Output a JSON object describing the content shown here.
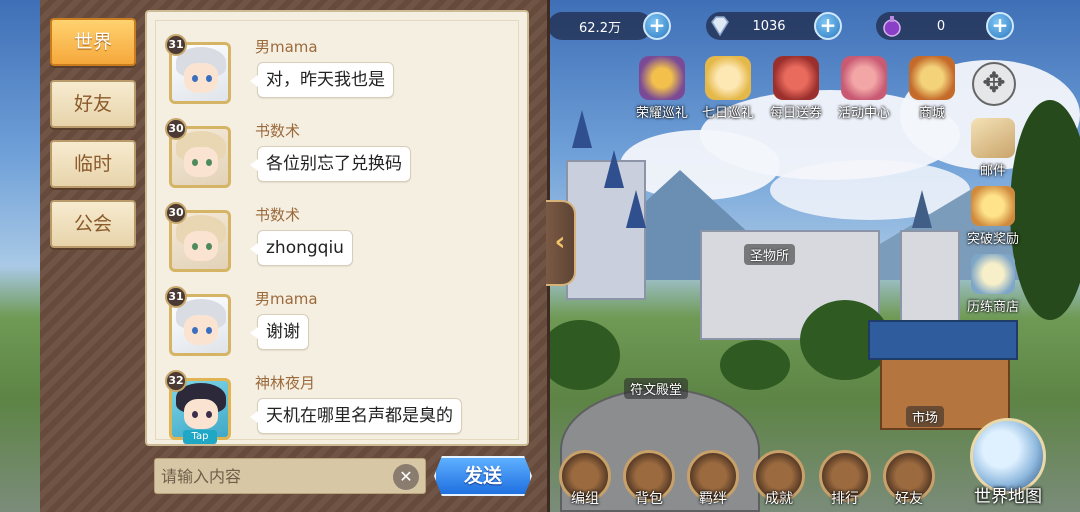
{
  "resources": {
    "gold": "62.2万",
    "diamonds": "1036",
    "potion": "0"
  },
  "features_top": [
    {
      "label": "荣耀巡礼",
      "icon": "honor-tour-icon"
    },
    {
      "label": "七日巡礼",
      "icon": "seven-day-icon"
    },
    {
      "label": "每日送券",
      "icon": "daily-ticket-icon"
    },
    {
      "label": "活动中心",
      "icon": "event-center-icon"
    },
    {
      "label": "商城",
      "icon": "shop-icon",
      "badge": "shop"
    }
  ],
  "features_side": [
    {
      "label": "邮件",
      "icon": "mail-icon"
    },
    {
      "label": "突破奖励",
      "icon": "breakthrough-reward-icon"
    },
    {
      "label": "历练商店",
      "icon": "training-shop-icon"
    }
  ],
  "places": {
    "relic": "圣物所",
    "rune": "符文殿堂",
    "market": "市场"
  },
  "bottom_menu": [
    {
      "label": "编组",
      "icon": "team-icon"
    },
    {
      "label": "背包",
      "icon": "bag-icon"
    },
    {
      "label": "羁绊",
      "icon": "bond-icon"
    },
    {
      "label": "成就",
      "icon": "achievement-icon"
    },
    {
      "label": "排行",
      "icon": "ranking-icon"
    },
    {
      "label": "好友",
      "icon": "friends-icon"
    }
  ],
  "world_map": {
    "label": "世界地图"
  },
  "chat": {
    "tabs": [
      {
        "label": "世界",
        "active": true
      },
      {
        "label": "好友",
        "active": false
      },
      {
        "label": "临时",
        "active": false
      },
      {
        "label": "公会",
        "active": false
      }
    ],
    "messages": [
      {
        "level": "31",
        "name": "男mama",
        "text": "对，昨天我也是",
        "avatar": "white-hair"
      },
      {
        "level": "30",
        "name": "书数术",
        "text": "各位别忘了兑换码",
        "avatar": "blonde-hair"
      },
      {
        "level": "30",
        "name": "书数术",
        "text": "zhongqiu",
        "avatar": "blonde-hair"
      },
      {
        "level": "31",
        "name": "男mama",
        "text": "谢谢",
        "avatar": "white-hair"
      },
      {
        "level": "32",
        "name": "神林夜月",
        "text": "天机在哪里名声都是臭的",
        "avatar": "dark-hair",
        "tag": "Tap"
      }
    ],
    "input_placeholder": "请输入内容",
    "send_label": "发送"
  },
  "colors": {
    "active_tab": "#f5a83b",
    "send_button": "#1f6fe0",
    "panel_bg": "#6a4e3e"
  }
}
